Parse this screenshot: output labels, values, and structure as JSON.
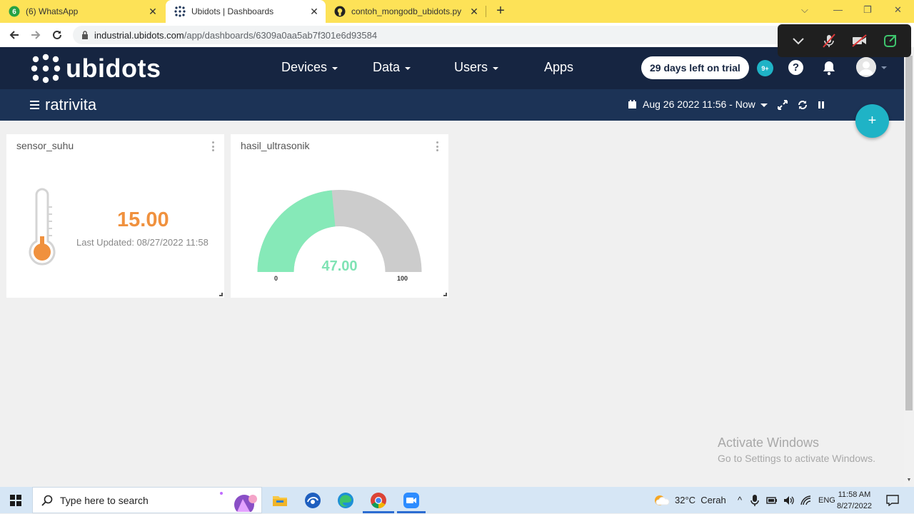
{
  "browser": {
    "tabs": [
      {
        "title": "(6) WhatsApp",
        "badge": "6"
      },
      {
        "title": "Ubidots | Dashboards"
      },
      {
        "title": "contoh_mongodb_ubidots.py"
      }
    ],
    "url_host": "industrial.ubidots.com",
    "url_path": "/app/dashboards/6309a0aa5ab7f301e6d93584"
  },
  "header": {
    "logo": "ubidots",
    "menu": [
      "Devices",
      "Data",
      "Users",
      "Apps"
    ],
    "trial": "29 days left on trial",
    "notif_badge": "9+",
    "help": "?"
  },
  "dashboard": {
    "name": "ratrivita",
    "date_range": "Aug 26 2022 11:56 - Now"
  },
  "widgets": {
    "thermometer": {
      "title": "sensor_suhu",
      "value": "15.00",
      "last_updated": "Last Updated: 08/27/2022 11:58",
      "color": "#f0913e"
    },
    "gauge": {
      "title": "hasil_ultrasonik",
      "value": "47.00",
      "value_numeric": 47,
      "min": "0",
      "max": "100",
      "fill_color": "#86e9b8",
      "track_color": "#cccccc"
    }
  },
  "watermark": {
    "line1": "Activate Windows",
    "line2": "Go to Settings to activate Windows."
  },
  "taskbar": {
    "search_placeholder": "Type here to search",
    "weather": "32°C  Cerah",
    "lang": "ENG",
    "time": "11:58 AM",
    "date": "8/27/2022"
  }
}
